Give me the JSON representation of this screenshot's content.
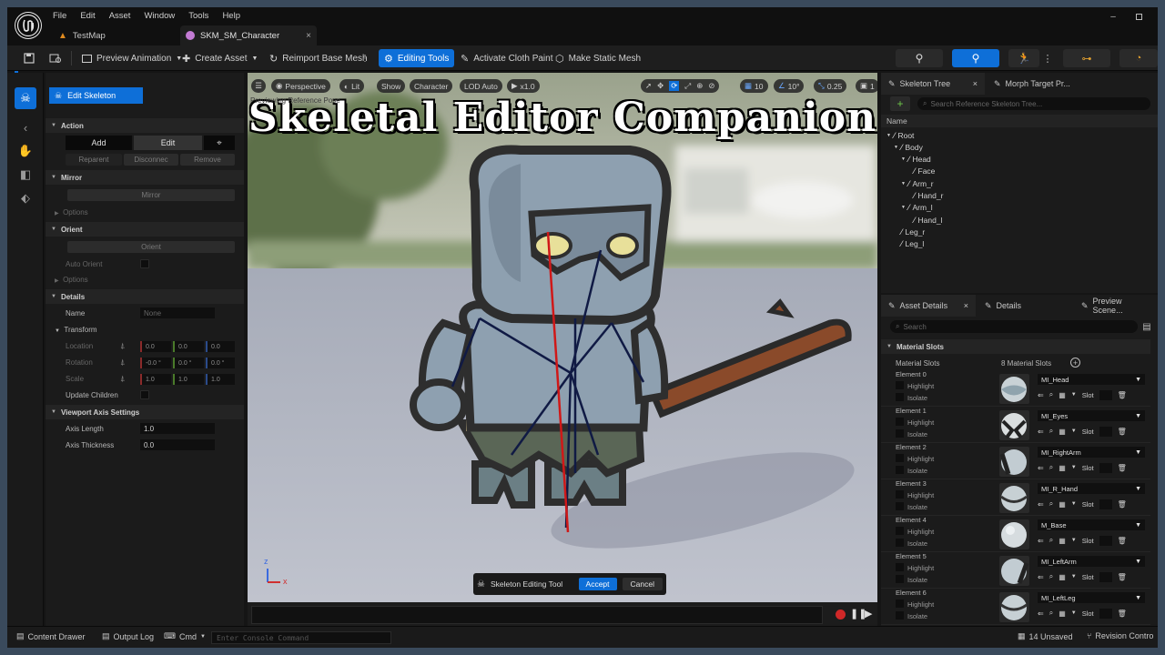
{
  "menu": [
    "File",
    "Edit",
    "Asset",
    "Window",
    "Tools",
    "Help"
  ],
  "tabs": [
    {
      "label": "TestMap"
    },
    {
      "label": "SKM_SM_Character"
    }
  ],
  "toolbar": {
    "preview_animation": "Preview Animation",
    "create_asset": "Create Asset",
    "reimport": "Reimport Base Mesh",
    "editing_tools": "Editing Tools",
    "activate_cloth": "Activate Cloth Paint",
    "make_static": "Make Static Mesh"
  },
  "left": {
    "mode_button": "Edit Skeleton",
    "action_title": "Action",
    "add": "Add",
    "edit": "Edit",
    "reparent": "Reparent",
    "disconnect": "Disconnec",
    "remove": "Remove",
    "mirror_title": "Mirror",
    "mirror_btn": "Mirror",
    "options": "Options",
    "orient_title": "Orient",
    "orient_btn": "Orient",
    "auto_orient": "Auto Orient",
    "details_title": "Details",
    "name_label": "Name",
    "name_value": "None",
    "transform_title": "Transform",
    "location": "Location",
    "rotation": "Rotation",
    "scale": "Scale",
    "loc_vals": [
      "0.0",
      "0.0",
      "0.0"
    ],
    "rot_vals": [
      "-0.0 °",
      "0.0 °",
      "0.0 °"
    ],
    "scale_vals": [
      "1.0",
      "1.0",
      "1.0"
    ],
    "update_children": "Update Children",
    "axis_title": "Viewport Axis Settings",
    "axis_length_label": "Axis Length",
    "axis_length": "1.0",
    "axis_thickness_label": "Axis Thickness",
    "axis_thickness": "0.0"
  },
  "viewport": {
    "perspective": "Perspective",
    "lit": "Lit",
    "show": "Show",
    "character": "Character",
    "lod": "LOD Auto",
    "speed": "x1.0",
    "grid": "10",
    "angle": "10°",
    "scale_snap": "0.25",
    "cams": "1",
    "previewing": "Previewing Reference Pose",
    "overlay_title": "Skeletal Editor Companion",
    "tool_name": "Skeleton Editing Tool",
    "accept": "Accept",
    "cancel": "Cancel",
    "axis_z": "z",
    "axis_x": "x"
  },
  "skeleton_tree": {
    "tab1": "Skeleton Tree",
    "tab2": "Morph Target Pr...",
    "search_placeholder": "Search Reference Skeleton Tree...",
    "col_name": "Name",
    "bones": [
      "Root",
      "Body",
      "Head",
      "Face",
      "Arm_r",
      "Hand_r",
      "Arm_l",
      "Hand_l",
      "Leg_r",
      "Leg_l"
    ]
  },
  "details": {
    "tab1": "Asset Details",
    "tab2": "Details",
    "tab3": "Preview Scene...",
    "search_placeholder": "Search",
    "section": "Material Slots",
    "slots_label": "Material Slots",
    "slots_count": "8 Material Slots",
    "highlight": "Highlight",
    "isolate": "Isolate",
    "slot": "Slot",
    "elements": [
      {
        "name": "Element 0",
        "material": "MI_Head"
      },
      {
        "name": "Element 1",
        "material": "MI_Eyes"
      },
      {
        "name": "Element 2",
        "material": "MI_RightArm"
      },
      {
        "name": "Element 3",
        "material": "MI_R_Hand"
      },
      {
        "name": "Element 4",
        "material": "M_Base"
      },
      {
        "name": "Element 5",
        "material": "MI_LeftArm"
      },
      {
        "name": "Element 6",
        "material": "MI_LeftLeg"
      }
    ]
  },
  "status": {
    "content_drawer": "Content Drawer",
    "output_log": "Output Log",
    "cmd": "Cmd",
    "console_placeholder": "Enter Console Command",
    "unsaved": "14 Unsaved",
    "revision": "Revision Contro"
  },
  "colors": {
    "accent": "#0e6fd8",
    "panel": "#1b1b1b",
    "bone_red": "#d01818",
    "bone_blue": "#101a44"
  }
}
